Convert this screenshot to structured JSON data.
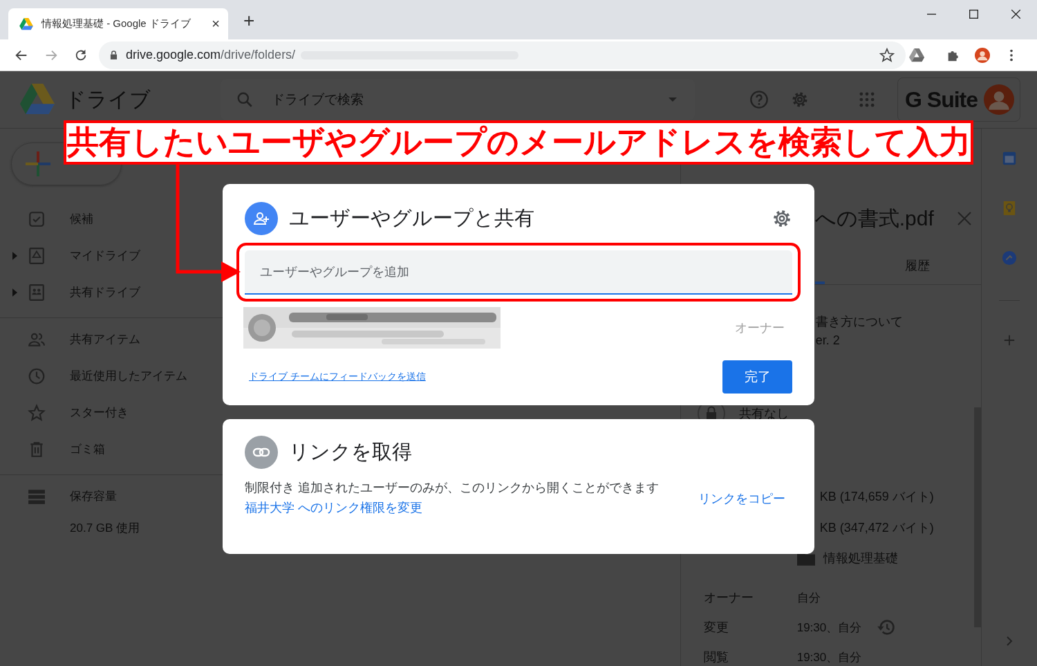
{
  "browser": {
    "tab": {
      "title": "情報処理基礎 - Google ドライブ",
      "close": "×"
    },
    "new_tab": "+",
    "url": {
      "host": "drive.google.com",
      "path": "/drive/folders/"
    }
  },
  "drive": {
    "app_name": "ドライブ",
    "search": {
      "placeholder": "ドライブで検索"
    },
    "brand": "G Suite"
  },
  "sidebar": {
    "groups": [
      [
        {
          "label": "候補",
          "expandable": false
        },
        {
          "label": "マイドライブ",
          "expandable": true
        },
        {
          "label": "共有ドライブ",
          "expandable": true
        }
      ],
      [
        {
          "label": "共有アイテム",
          "expandable": false
        },
        {
          "label": "最近使用したアイテム",
          "expandable": false
        },
        {
          "label": "スター付き",
          "expandable": false
        },
        {
          "label": "ゴミ箱",
          "expandable": false
        }
      ]
    ],
    "storage": {
      "label": "保存容量",
      "usage": "20.7 GB 使用"
    }
  },
  "details": {
    "title": "への書式.pdf",
    "tabs": [
      {
        "label": "履歴",
        "selected": false
      }
    ],
    "description_lines": [
      "書き方について",
      "er. 2"
    ],
    "sharing": "共有なし",
    "sizes": [
      "KB (174,659 バイト)",
      "KB (347,472 バイト)"
    ],
    "location": "情報処理基礎",
    "meta": [
      {
        "label": "オーナー",
        "value": "自分",
        "history": false
      },
      {
        "label": "変更",
        "value": "19:30、自分",
        "history": true
      },
      {
        "label": "閲覧",
        "value": "19:30、自分",
        "history": false
      }
    ]
  },
  "share_dialog": {
    "title": "ユーザーやグループと共有",
    "input": {
      "placeholder": "ユーザーやグループを追加"
    },
    "owner": {
      "role": "オーナー"
    },
    "feedback_link": "ドライブ チームにフィードバックを送信",
    "done_button": "完了"
  },
  "link_dialog": {
    "title": "リンクを取得",
    "description": "制限付き 追加されたユーザーのみが、このリンクから開くことができます",
    "change_link": "福井大学 へのリンク権限を変更",
    "copy_link": "リンクをコピー"
  },
  "annotation": {
    "text": "共有したいユーザやグループのメールアドレスを検索して入力"
  }
}
